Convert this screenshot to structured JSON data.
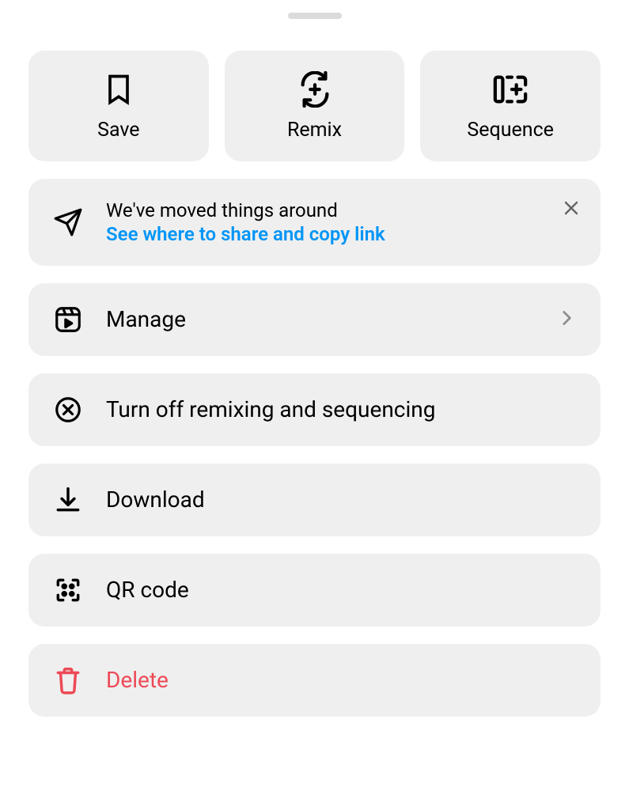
{
  "top": {
    "save": "Save",
    "remix": "Remix",
    "sequence": "Sequence"
  },
  "notice": {
    "title": "We've moved things around",
    "link": "See where to share and copy link"
  },
  "menu": {
    "manage": "Manage",
    "turnOffRemix": "Turn off remixing and sequencing",
    "download": "Download",
    "qr": "QR code",
    "delete": "Delete"
  }
}
